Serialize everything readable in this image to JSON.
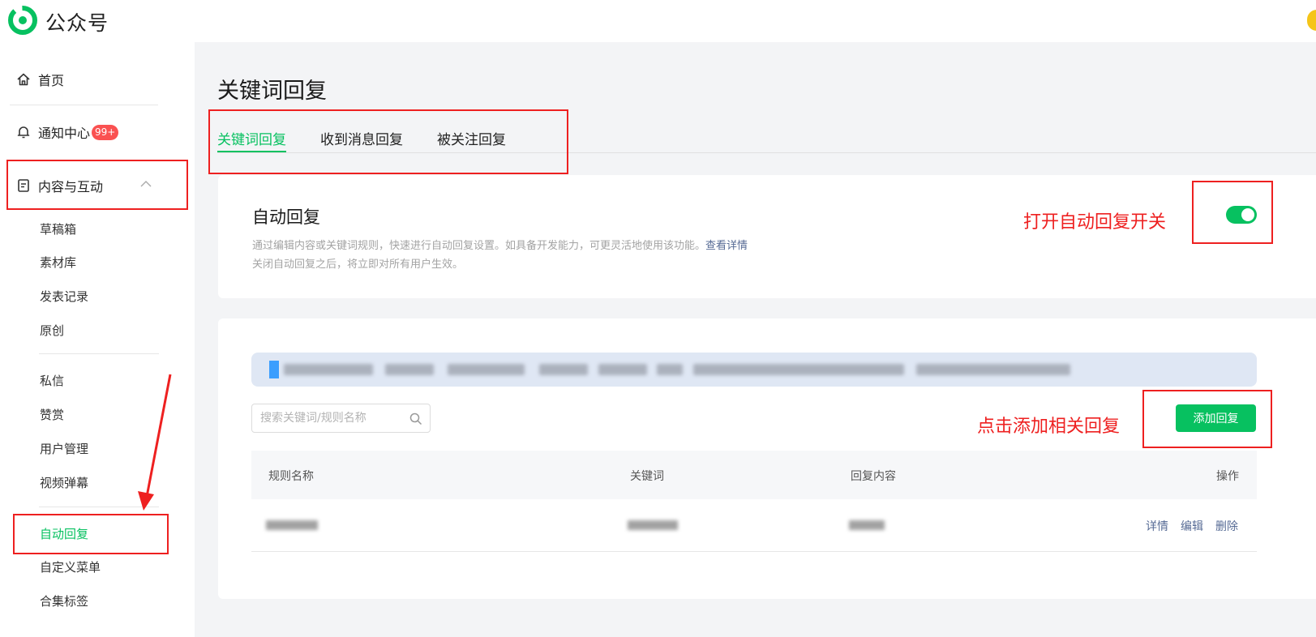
{
  "app": {
    "brand": "公众号",
    "logo_icon": "wechat-official-account-logo-icon"
  },
  "sidebar": {
    "home": {
      "label": "首页",
      "icon": "home-icon"
    },
    "notifications": {
      "label": "通知中心",
      "badge": "99+",
      "icon": "bell-icon"
    },
    "content_group": {
      "label": "内容与互动",
      "icon": "document-icon",
      "expanded": true
    },
    "content_items": [
      "草稿箱",
      "素材库",
      "发表记录",
      "原创"
    ],
    "interaction_items": [
      "私信",
      "赞赏",
      "用户管理",
      "视频弹幕"
    ],
    "setting_items": [
      "自动回复",
      "自定义菜单",
      "合集标签"
    ],
    "active_item": "自动回复"
  },
  "main": {
    "page_title": "关键词回复",
    "tabs": [
      "关键词回复",
      "收到消息回复",
      "被关注回复"
    ],
    "active_tab": "关键词回复",
    "auto_reply": {
      "title": "自动回复",
      "desc_line1": "通过编辑内容或关键词规则，快速进行自动回复设置。如具备开发能力，可更灵活地使用该功能。",
      "desc_link": "查看详情",
      "desc_line2": "关闭自动回复之后，将立即对所有用户生效。",
      "toggle_on": true
    },
    "search": {
      "placeholder": "搜索关键词/规则名称",
      "value": ""
    },
    "add_button": "添加回复",
    "table": {
      "headers": {
        "rule_name": "规则名称",
        "keyword": "关键词",
        "reply_content": "回复内容",
        "actions": "操作"
      },
      "row_actions": [
        "详情",
        "编辑",
        "删除"
      ]
    }
  },
  "annotations": {
    "toggle_hint": "打开自动回复开关",
    "add_hint": "点击添加相关回复"
  },
  "colors": {
    "accent": "#07c160",
    "link": "#576b95",
    "annotation": "#ee2020",
    "badge": "#fa5151"
  }
}
